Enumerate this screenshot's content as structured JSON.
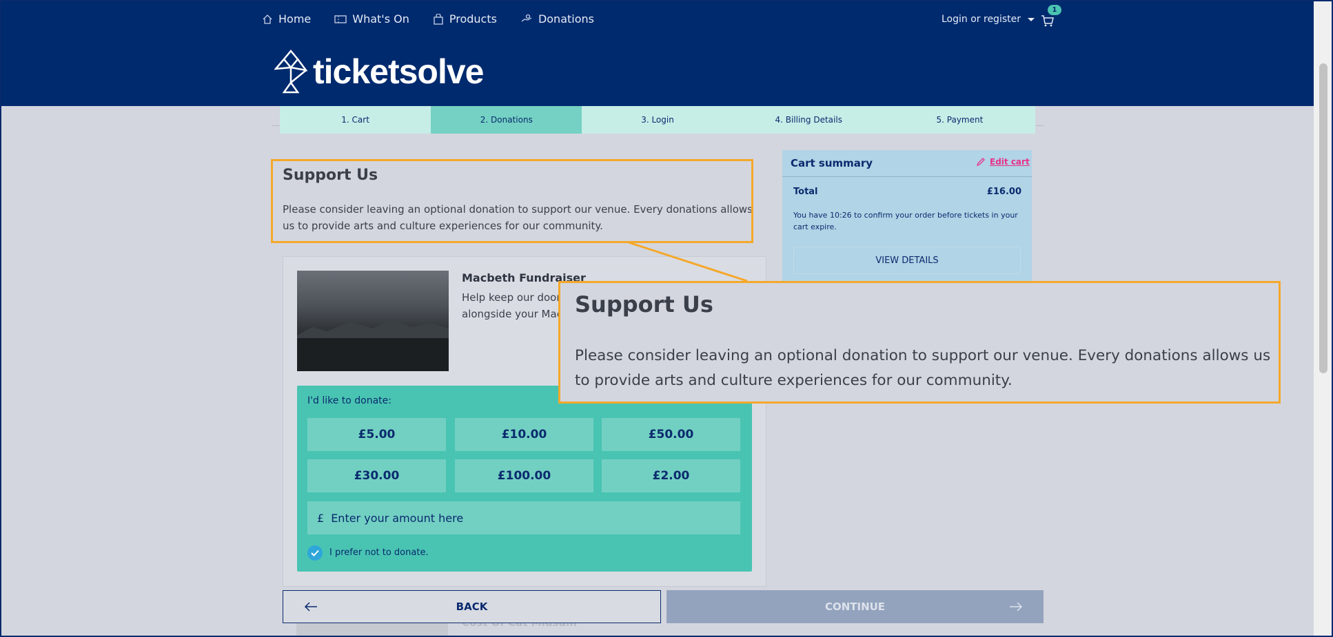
{
  "nav": {
    "items": [
      {
        "label": "Home",
        "icon": "home-icon"
      },
      {
        "label": "What's On",
        "icon": "ticket-icon"
      },
      {
        "label": "Products",
        "icon": "bag-icon"
      },
      {
        "label": "Donations",
        "icon": "donation-icon"
      }
    ],
    "login_label": "Login or register",
    "cart_count": "1"
  },
  "brand": {
    "name": "ticketsolve"
  },
  "steps": [
    "1. Cart",
    "2. Donations",
    "3. Login",
    "4. Billing Details",
    "5. Payment"
  ],
  "support": {
    "title": "Support Us",
    "text": "Please consider leaving an optional donation to support our venue. Every donations allows us to provide arts and culture experiences for our community."
  },
  "donation": {
    "title": "Macbeth Fundraiser",
    "description_line1": "Help keep our doors",
    "description_line2": "alongside your Mac",
    "label": "I'd like to donate:",
    "amounts": [
      "£5.00",
      "£10.00",
      "£50.00",
      "£30.00",
      "£100.00",
      "£2.00"
    ],
    "currency_symbol": "£",
    "amount_placeholder": "Enter your amount here",
    "opt_out_label": "I prefer not to donate.",
    "next_title": "Cost Of Cat Midsum"
  },
  "buttons": {
    "back": "BACK",
    "continue": "CONTINUE"
  },
  "cart_summary": {
    "title": "Cart summary",
    "edit_label": "Edit cart",
    "total_label": "Total",
    "total_value": "£16.00",
    "timer_text": "You have 10:26 to confirm your order before tickets in your cart expire.",
    "view_details": "VIEW DETAILS"
  },
  "colors": {
    "header": "#002a6e",
    "accent_teal": "#49c4b2",
    "highlight": "#f5a82b",
    "edit_link": "#e8318a"
  }
}
